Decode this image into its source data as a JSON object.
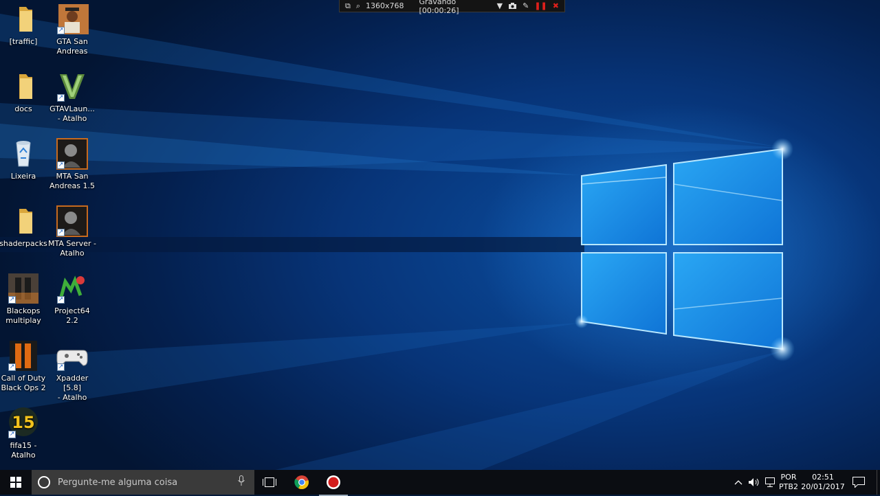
{
  "recorder": {
    "resolution": "1360x768",
    "status": "Gravando [00:00:26]"
  },
  "desktop_icons": [
    {
      "id": "traffic",
      "label_lines": [
        "[traffic]"
      ],
      "icon": "folder-icon"
    },
    {
      "id": "gta-sa",
      "label_lines": [
        "GTA San",
        "Andreas"
      ],
      "icon": "gta-san-andreas-icon"
    },
    {
      "id": "docs",
      "label_lines": [
        "docs"
      ],
      "icon": "folder-icon"
    },
    {
      "id": "gtav",
      "label_lines": [
        "GTAVLaun...",
        "- Atalho"
      ],
      "icon": "gta-v-icon"
    },
    {
      "id": "lixeira",
      "label_lines": [
        "Lixeira"
      ],
      "icon": "recycle-bin-icon"
    },
    {
      "id": "mta-sa",
      "label_lines": [
        "MTA San",
        "Andreas 1.5"
      ],
      "icon": "mta-icon"
    },
    {
      "id": "shaderpacks",
      "label_lines": [
        "shaderpacks"
      ],
      "icon": "folder-icon"
    },
    {
      "id": "mta-server",
      "label_lines": [
        "MTA Server -",
        "Atalho"
      ],
      "icon": "mta-icon"
    },
    {
      "id": "blackops-mp",
      "label_lines": [
        "Blackops",
        "multiplay"
      ],
      "icon": "black-ops-icon"
    },
    {
      "id": "project64",
      "label_lines": [
        "Project64 2.2"
      ],
      "icon": "project64-icon"
    },
    {
      "id": "cod-bo2",
      "label_lines": [
        "Call of Duty",
        "Black Ops 2"
      ],
      "icon": "black-ops-2-icon"
    },
    {
      "id": "xpadder",
      "label_lines": [
        "Xpadder [5.8]",
        "- Atalho"
      ],
      "icon": "gamepad-icon"
    },
    {
      "id": "fifa15",
      "label_lines": [
        "fifa15 -",
        "Atalho"
      ],
      "icon": "fifa15-icon"
    }
  ],
  "fifa_badge": "15",
  "taskbar": {
    "search_placeholder": "Pergunte-me alguma coisa",
    "language": "POR",
    "keyboard": "PTB2",
    "time": "02:51",
    "date": "20/01/2017"
  },
  "colors": {
    "taskbar": "#0b0d12",
    "search_box": "#3a3a3a",
    "recorder_red": "#e0201b",
    "folder_yellow": "#e8c35a"
  }
}
